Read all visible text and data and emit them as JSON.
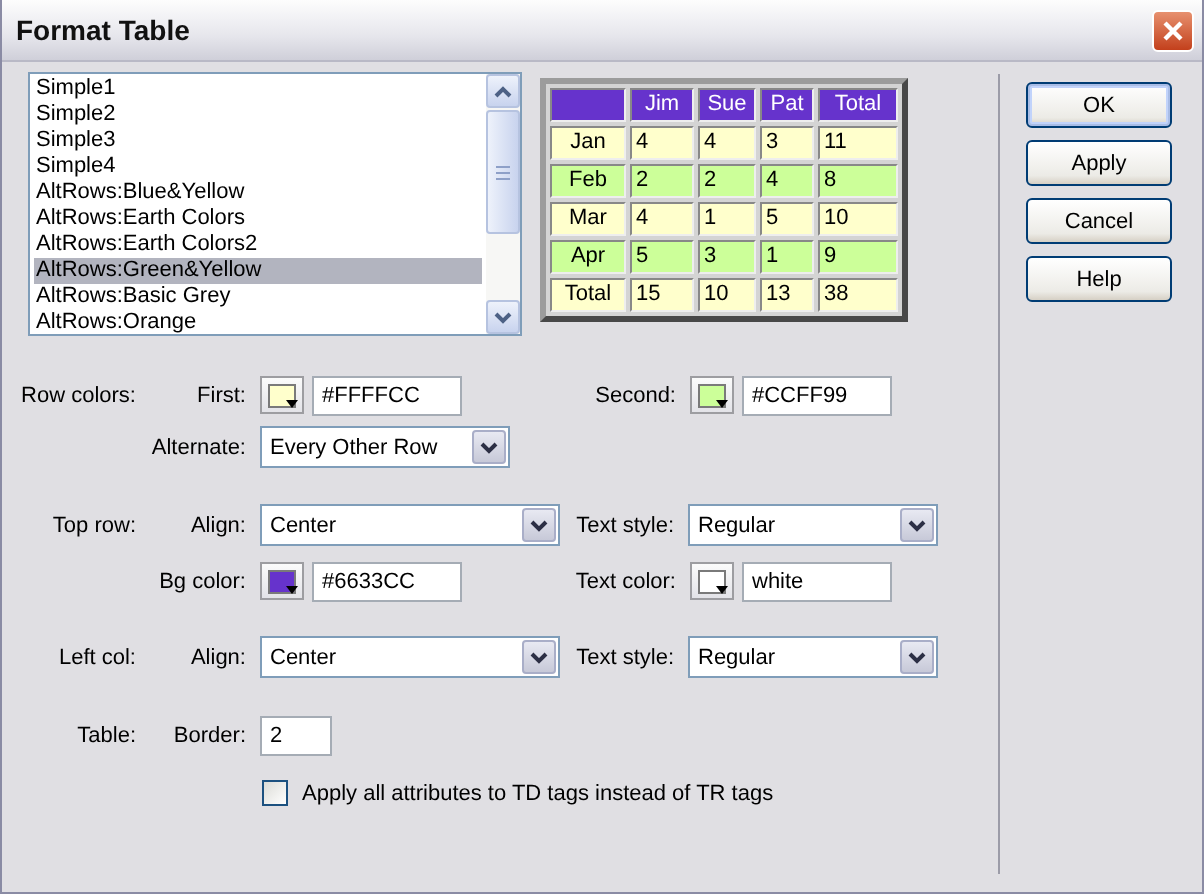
{
  "window": {
    "title": "Format Table"
  },
  "style_list": {
    "items": [
      {
        "label": "Simple1",
        "selected": false
      },
      {
        "label": "Simple2",
        "selected": false
      },
      {
        "label": "Simple3",
        "selected": false
      },
      {
        "label": "Simple4",
        "selected": false
      },
      {
        "label": "AltRows:Blue&Yellow",
        "selected": false
      },
      {
        "label": "AltRows:Earth Colors",
        "selected": false
      },
      {
        "label": "AltRows:Earth Colors2",
        "selected": false
      },
      {
        "label": "AltRows:Green&Yellow",
        "selected": true
      },
      {
        "label": "AltRows:Basic Grey",
        "selected": false
      },
      {
        "label": "AltRows:Orange",
        "selected": false
      }
    ]
  },
  "preview": {
    "header": [
      "Jim",
      "Sue",
      "Pat",
      "Total"
    ],
    "rows": [
      {
        "kind": "first",
        "cells": [
          "Jan",
          "4",
          "4",
          "3",
          "11"
        ]
      },
      {
        "kind": "second",
        "cells": [
          "Feb",
          "2",
          "2",
          "4",
          "8"
        ]
      },
      {
        "kind": "first",
        "cells": [
          "Mar",
          "4",
          "1",
          "5",
          "10"
        ]
      },
      {
        "kind": "second",
        "cells": [
          "Apr",
          "5",
          "3",
          "1",
          "9"
        ]
      },
      {
        "kind": "first",
        "cells": [
          "Total",
          "15",
          "10",
          "13",
          "38"
        ]
      }
    ]
  },
  "row_colors": {
    "label": "Row colors:",
    "first": {
      "label": "First:",
      "color": "#ffffcc",
      "value": "#FFFFCC"
    },
    "second": {
      "label": "Second:",
      "color": "#ccff99",
      "value": "#CCFF99"
    },
    "alternate": {
      "label": "Alternate:",
      "value": "Every Other Row"
    }
  },
  "top_row": {
    "label": "Top row:",
    "align": {
      "label": "Align:",
      "value": "Center"
    },
    "text_style": {
      "label": "Text style:",
      "value": "Regular"
    },
    "bg_color": {
      "label": "Bg color:",
      "color": "#6633cc",
      "value": "#6633CC"
    },
    "text_color": {
      "label": "Text color:",
      "color": "#ffffff",
      "value": "white"
    }
  },
  "left_col": {
    "label": "Left col:",
    "align": {
      "label": "Align:",
      "value": "Center"
    },
    "text_style": {
      "label": "Text style:",
      "value": "Regular"
    }
  },
  "table": {
    "label": "Table:",
    "border": {
      "label": "Border:",
      "value": "2"
    }
  },
  "td_option": {
    "label": "Apply all attributes to TD tags instead of TR tags",
    "checked": false
  },
  "buttons": [
    {
      "label": "OK",
      "default": true
    },
    {
      "label": "Apply",
      "default": false
    },
    {
      "label": "Cancel",
      "default": false
    },
    {
      "label": "Help",
      "default": false
    }
  ]
}
